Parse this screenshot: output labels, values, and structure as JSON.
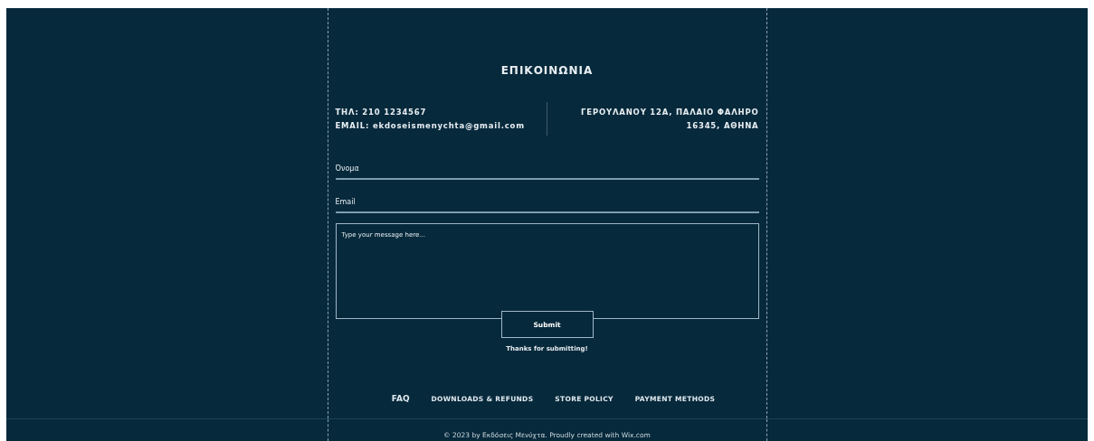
{
  "heading": "ΕΠΙΚΟΙΝΩΝΙΑ",
  "contact_left": [
    "ΤΗΛ: 210 1234567",
    "EMAIL: ekdoseismenychta@gmail.com"
  ],
  "contact_right": [
    "ΓΕΡΟΥΛΑΝΟΥ 12Α, ΠΑΛΑΙΟ ΦΑΛΗΡΟ",
    "16345, ΑΘΗΝΑ"
  ],
  "form": {
    "fields": [
      {
        "kind": "line",
        "placeholder": "Όνομα"
      },
      {
        "kind": "line",
        "placeholder": "Email"
      },
      {
        "kind": "area",
        "placeholder": "Type your message here..."
      }
    ],
    "submit": "Submit",
    "confirmation": "Thanks for submitting!"
  },
  "footer_links": [
    {
      "label": "FAQ",
      "kind": "plain"
    },
    {
      "label": "DOWNLOADS & REFUNDS",
      "kind": "small"
    },
    {
      "label": "STORE POLICY",
      "kind": "small"
    },
    {
      "label": "PAYMENT METHODS",
      "kind": "small"
    }
  ],
  "copyright": "© 2023 by Εκδόσεις Μενύχτα. Proudly created with Wix.com"
}
